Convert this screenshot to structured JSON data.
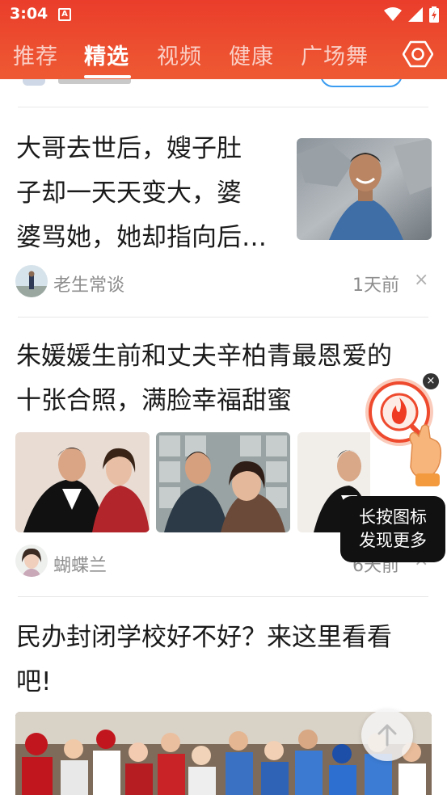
{
  "status_bar": {
    "time": "3:04",
    "notification_icon": "A"
  },
  "tabs": [
    {
      "label": "推荐",
      "active": false
    },
    {
      "label": "精选",
      "active": true
    },
    {
      "label": "视频",
      "active": false
    },
    {
      "label": "健康",
      "active": false
    },
    {
      "label": "广场舞",
      "active": false
    }
  ],
  "articles": [
    {
      "title_lines": [
        "大哥去世后，嫂子肚",
        "子却一天天变大，婆",
        "婆骂她，她却指向后…"
      ],
      "author": "老生常谈",
      "time": "1天前",
      "close": "×"
    },
    {
      "title_lines": [
        "朱媛媛生前和丈夫辛柏青最恩爱的",
        "十张合照，满脸幸福甜蜜"
      ],
      "author": "蝴蝶兰",
      "time": "6天前",
      "close": "×"
    },
    {
      "title_lines": [
        "民办封闭学校好不好？来这里看看",
        "吧!"
      ]
    }
  ],
  "widget": {
    "close": "×",
    "tooltip_lines": [
      "长按图标",
      "发现更多"
    ]
  },
  "colors": {
    "header": "#ea3d2b",
    "accent_blue": "#3a9cf0"
  },
  "icons": [
    "wifi-icon",
    "signal-icon",
    "battery-icon",
    "settings-icon",
    "scroll-top-arrow-icon"
  ]
}
